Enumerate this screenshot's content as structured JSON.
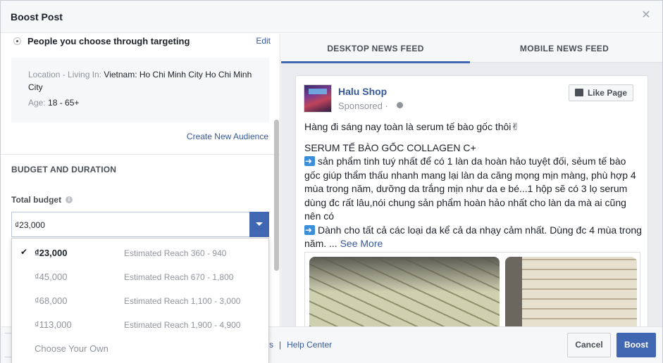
{
  "dialog": {
    "title": "Boost Post",
    "close_icon": "close-icon"
  },
  "audience": {
    "option_label": "People you choose through targeting",
    "edit_label": "Edit",
    "location_label": "Location - Living In:",
    "location_value": "Vietnam: Ho Chi Minh City Ho Chi Minh City",
    "age_label": "Age:",
    "age_value": "18 - 65+",
    "create_new_label": "Create New Audience"
  },
  "budget": {
    "section_title": "BUDGET AND DURATION",
    "total_label": "Total budget",
    "info_icon": "info-icon",
    "selected_value": "₫23,000",
    "options": [
      {
        "amount": "₫23,000",
        "reach": "Estimated Reach 360 - 940",
        "selected": true,
        "check": "✔"
      },
      {
        "amount": "₫45,000",
        "reach": "Estimated Reach 670 - 1,800",
        "selected": false,
        "check": ""
      },
      {
        "amount": "₫68,000",
        "reach": "Estimated Reach 1,100 - 3,000",
        "selected": false,
        "check": ""
      },
      {
        "amount": "₫113,000",
        "reach": "Estimated Reach 1,900 - 4,900",
        "selected": false,
        "check": ""
      },
      {
        "amount": "Choose Your Own",
        "reach": "",
        "selected": false,
        "check": ""
      }
    ]
  },
  "preview": {
    "tabs": [
      {
        "label": "DESKTOP NEWS FEED",
        "active": true
      },
      {
        "label": "MOBILE NEWS FEED",
        "active": false
      }
    ],
    "page_name": "Halu Shop",
    "sponsored": "Sponsored ·",
    "like_page_label": "Like Page",
    "text_line1": "Hàng đi sáng nay toàn là serum tế bào gốc thôi✌",
    "text_line2": "SERUM TẾ BÀO GỐC COLLAGEN C+",
    "text_line3": "sản phẩm tinh tuý nhất để có 1 làn da hoàn hảo tuyệt đối, sẻum tế bào gốc giúp thẩm thấu nhanh mang lại làn da căng mọng mịn màng, phù hợp 4 mùa trong năm, dưỡng da trắng mịn như da e bé...1 hộp sẽ có 3 lọ serum dùng đc rất lâu,nói chung sản phẩm hoàn hảo nhất cho làn da mà ai cũng nên có",
    "text_line4": "Dành cho tất cả các loại da kể cả da nhạy cảm nhất. Dùng đc 4 mùa trong năm. ...",
    "see_more": "See More"
  },
  "footer": {
    "link_partial": "s",
    "separator": "|",
    "help_center": "Help Center",
    "cancel_label": "Cancel",
    "boost_label": "Boost"
  },
  "colors": {
    "accent": "#4267b2",
    "link": "#365899",
    "muted": "#90949c"
  }
}
